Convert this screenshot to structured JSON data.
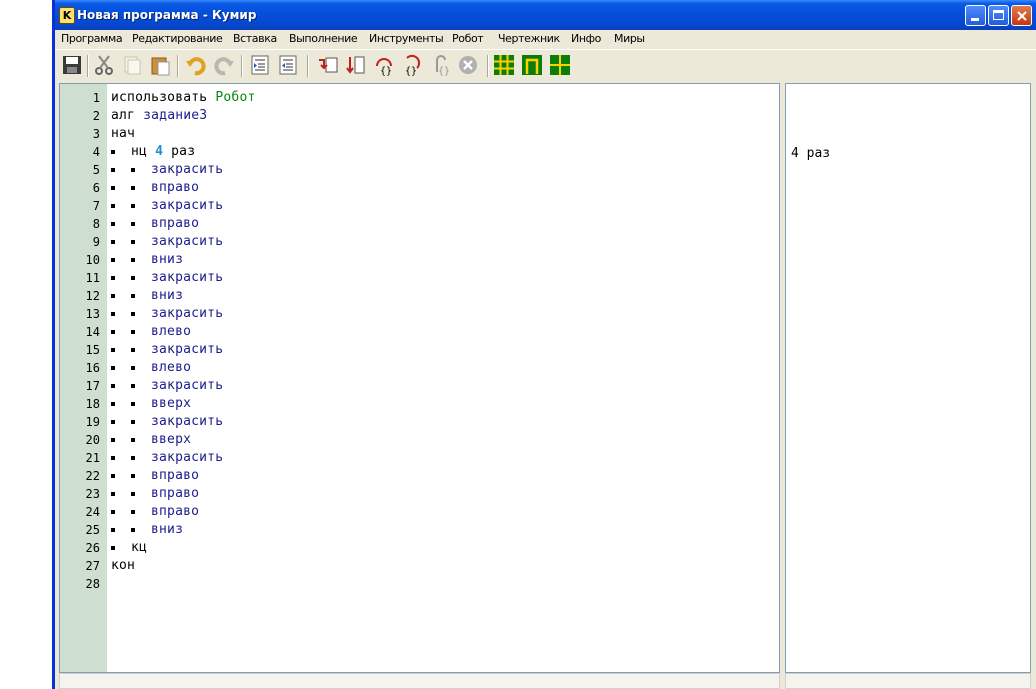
{
  "window": {
    "title": "Новая программа - Кумир",
    "app_icon_letter": "K"
  },
  "menu": [
    "Программа",
    "Редактирование",
    "Вставка",
    "Выполнение",
    "Инструменты",
    "Робот",
    "Чертежник",
    "Инфо",
    "Миры"
  ],
  "toolbar": {
    "icons": [
      "save-icon",
      "cut-icon",
      "copy-icon",
      "paste-icon",
      "undo-icon",
      "redo-icon",
      "indent-icon",
      "unindent-icon",
      "run-icon",
      "step-icon",
      "step-into-icon",
      "step-out-icon",
      "step-back-icon",
      "stop-icon",
      "robot-field-icon",
      "robot-window-icon",
      "draftsman-icon"
    ]
  },
  "editor": {
    "lines": [
      {
        "n": "1",
        "indent": 0,
        "parts": [
          [
            "kw",
            "использовать "
          ],
          [
            "mod",
            "Робот"
          ]
        ]
      },
      {
        "n": "2",
        "indent": 0,
        "parts": [
          [
            "kw",
            "алг "
          ],
          [
            "fn",
            "задание3"
          ]
        ]
      },
      {
        "n": "3",
        "indent": 0,
        "parts": [
          [
            "kw",
            "нач"
          ]
        ]
      },
      {
        "n": "4",
        "indent": 1,
        "parts": [
          [
            "kw",
            "нц "
          ],
          [
            "num",
            "4"
          ],
          [
            "kw",
            " раз"
          ]
        ]
      },
      {
        "n": "5",
        "indent": 2,
        "parts": [
          [
            "fn",
            "закрасить"
          ]
        ]
      },
      {
        "n": "6",
        "indent": 2,
        "parts": [
          [
            "fn",
            "вправо"
          ]
        ]
      },
      {
        "n": "7",
        "indent": 2,
        "parts": [
          [
            "fn",
            "закрасить"
          ]
        ]
      },
      {
        "n": "8",
        "indent": 2,
        "parts": [
          [
            "fn",
            "вправо"
          ]
        ]
      },
      {
        "n": "9",
        "indent": 2,
        "parts": [
          [
            "fn",
            "закрасить"
          ]
        ]
      },
      {
        "n": "10",
        "indent": 2,
        "parts": [
          [
            "fn",
            "вниз"
          ]
        ]
      },
      {
        "n": "11",
        "indent": 2,
        "parts": [
          [
            "fn",
            "закрасить"
          ]
        ]
      },
      {
        "n": "12",
        "indent": 2,
        "parts": [
          [
            "fn",
            "вниз"
          ]
        ]
      },
      {
        "n": "13",
        "indent": 2,
        "parts": [
          [
            "fn",
            "закрасить"
          ]
        ]
      },
      {
        "n": "14",
        "indent": 2,
        "parts": [
          [
            "fn",
            "влево"
          ]
        ]
      },
      {
        "n": "15",
        "indent": 2,
        "parts": [
          [
            "fn",
            "закрасить"
          ]
        ]
      },
      {
        "n": "16",
        "indent": 2,
        "parts": [
          [
            "fn",
            "влево"
          ]
        ]
      },
      {
        "n": "17",
        "indent": 2,
        "parts": [
          [
            "fn",
            "закрасить"
          ]
        ]
      },
      {
        "n": "18",
        "indent": 2,
        "parts": [
          [
            "fn",
            "вверх"
          ]
        ]
      },
      {
        "n": "19",
        "indent": 2,
        "parts": [
          [
            "fn",
            "закрасить"
          ]
        ]
      },
      {
        "n": "20",
        "indent": 2,
        "parts": [
          [
            "fn",
            "вверх"
          ]
        ]
      },
      {
        "n": "21",
        "indent": 2,
        "parts": [
          [
            "fn",
            "закрасить"
          ]
        ]
      },
      {
        "n": "22",
        "indent": 2,
        "parts": [
          [
            "fn",
            "вправо"
          ]
        ]
      },
      {
        "n": "23",
        "indent": 2,
        "parts": [
          [
            "fn",
            "вправо"
          ]
        ]
      },
      {
        "n": "24",
        "indent": 2,
        "parts": [
          [
            "fn",
            "вправо"
          ]
        ]
      },
      {
        "n": "25",
        "indent": 2,
        "parts": [
          [
            "fn",
            "вниз"
          ]
        ]
      },
      {
        "n": "26",
        "indent": 1,
        "parts": [
          [
            "kw",
            "кц"
          ]
        ]
      },
      {
        "n": "27",
        "indent": 0,
        "parts": [
          [
            "kw",
            "кон"
          ]
        ]
      },
      {
        "n": "28",
        "indent": 0,
        "parts": []
      }
    ]
  },
  "margin": {
    "line4": "4 раз"
  },
  "colors": {
    "keyword": "#000000",
    "function": "#1c1c8c",
    "module": "#0a8a0a",
    "number": "#1a8fd0",
    "gutter": "#cfdfcf"
  }
}
